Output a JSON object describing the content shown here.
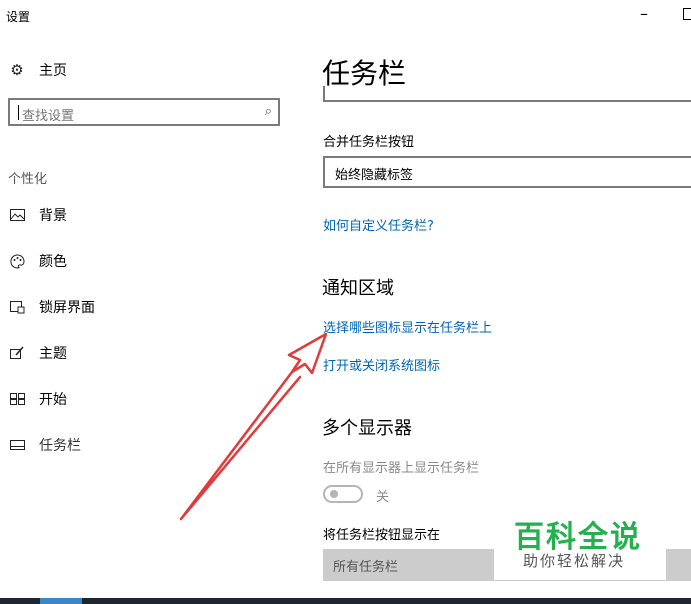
{
  "window": {
    "title": "设置"
  },
  "sidebar": {
    "home_label": "主页",
    "search_placeholder": "查找设置",
    "section_title": "个性化",
    "items": [
      {
        "label": "背景",
        "icon": "image-icon"
      },
      {
        "label": "颜色",
        "icon": "palette-icon"
      },
      {
        "label": "锁屏界面",
        "icon": "lock-screen-icon"
      },
      {
        "label": "主题",
        "icon": "theme-icon"
      },
      {
        "label": "开始",
        "icon": "start-icon"
      },
      {
        "label": "任务栏",
        "icon": "taskbar-icon",
        "active": true
      }
    ]
  },
  "main": {
    "title": "任务栏",
    "combine_label": "合并任务栏按钮",
    "combine_value": "始终隐藏标签",
    "customize_link": "如何自定义任务栏?",
    "notification_heading": "通知区域",
    "notification_link_1": "选择哪些图标显示在任务栏上",
    "notification_link_2": "打开或关闭系统图标",
    "multi_display_heading": "多个显示器",
    "show_on_all_label": "在所有显示器上显示任务栏",
    "toggle_state": "关",
    "show_buttons_label": "将任务栏按钮显示在",
    "show_buttons_value": "所有任务栏"
  },
  "watermark": {
    "title": "百科全说",
    "subtitle": "助你轻松解决"
  },
  "colors": {
    "link": "#0066b4",
    "annotation_arrow": "#e03a3a",
    "watermark_green": "#22b14c"
  }
}
